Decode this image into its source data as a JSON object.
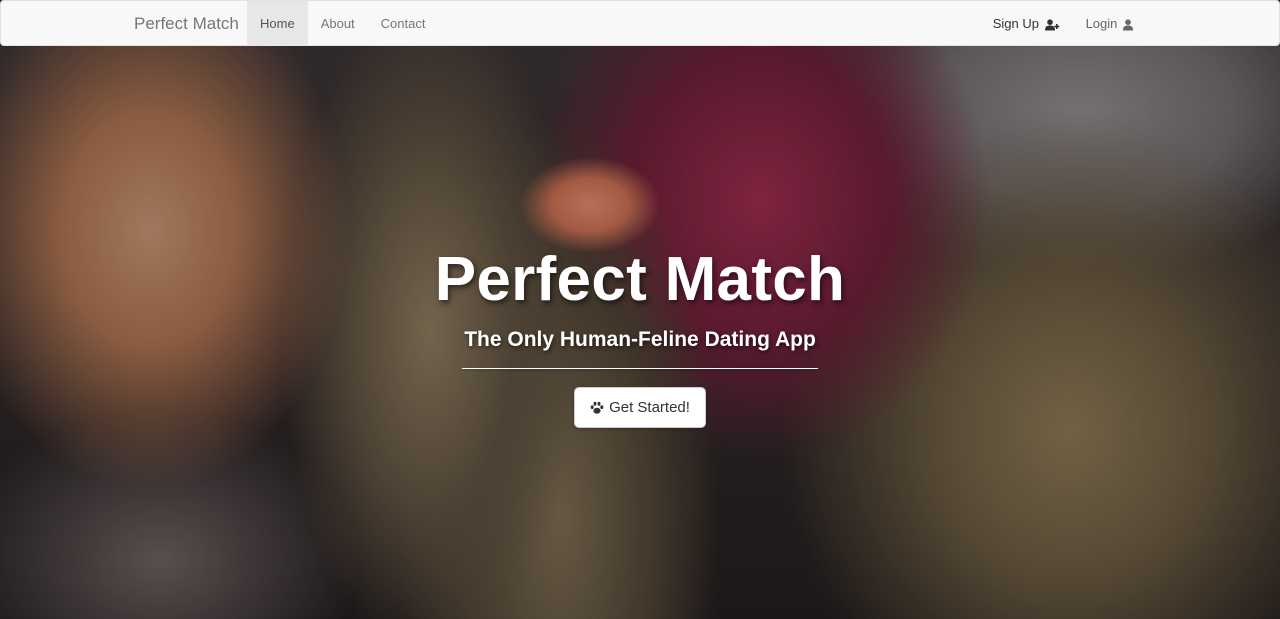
{
  "navbar": {
    "brand": "Perfect Match",
    "links": [
      {
        "label": "Home",
        "active": true
      },
      {
        "label": "About",
        "active": false
      },
      {
        "label": "Contact",
        "active": false
      }
    ],
    "right": {
      "signup_label": "Sign Up",
      "signup_icon": "user-plus-icon",
      "login_label": "Login",
      "login_icon": "user-icon"
    }
  },
  "hero": {
    "title": "Perfect Match",
    "subtitle": "The Only Human-Feline Dating App",
    "cta_label": "Get Started!",
    "cta_icon": "paw-icon"
  },
  "colors": {
    "navbar_bg": "#f8f8f8",
    "active_tab_bg": "#e7e7e7",
    "hero_text": "#ffffff"
  }
}
